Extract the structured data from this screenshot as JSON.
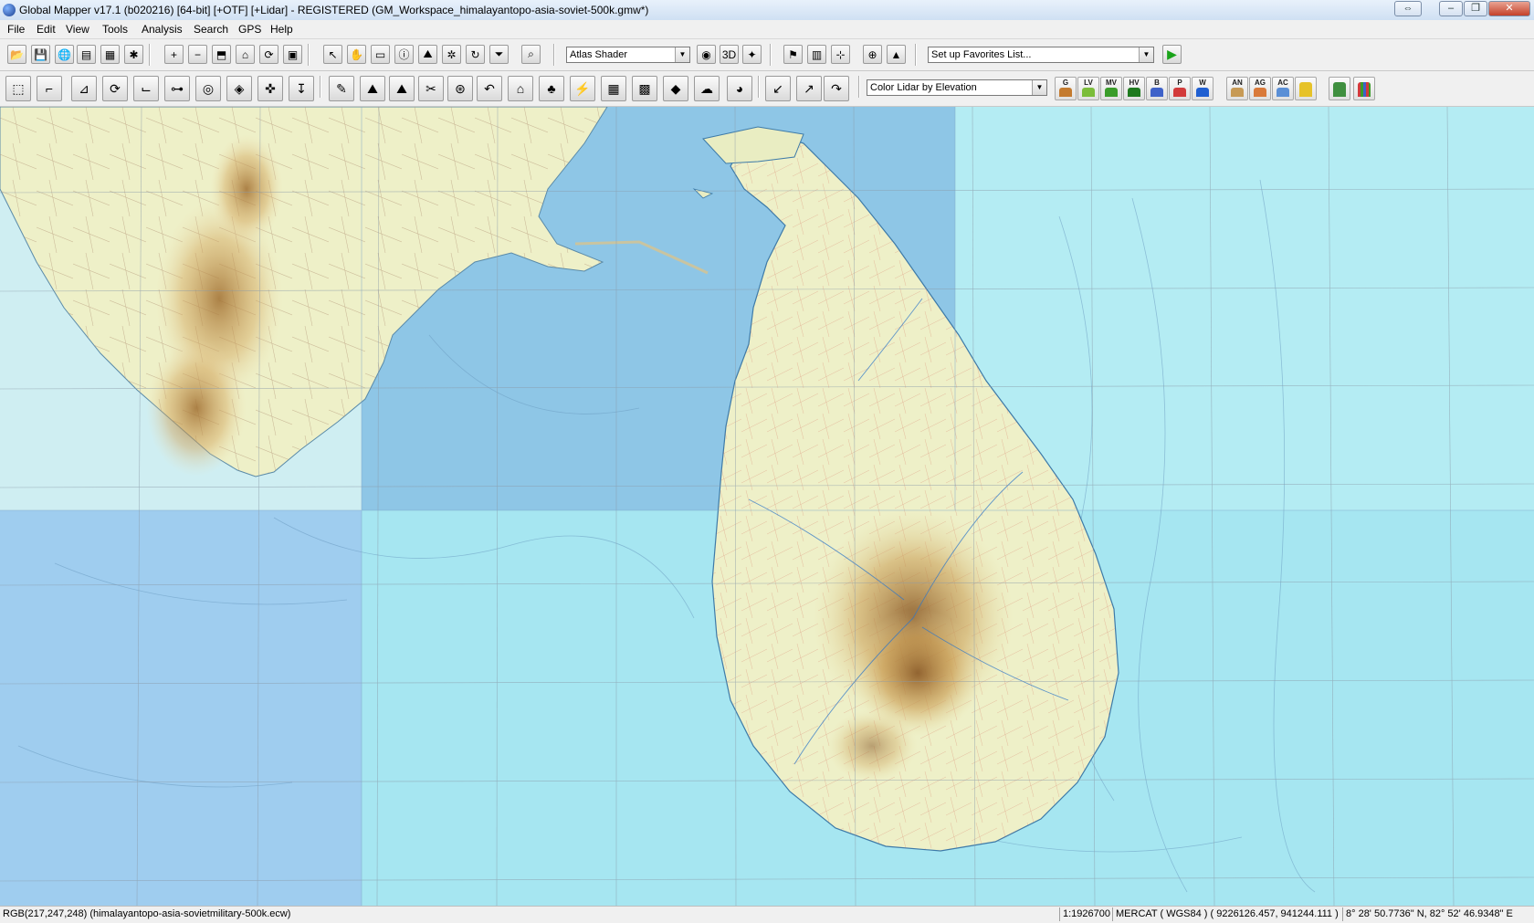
{
  "window": {
    "title": "Global Mapper v17.1 (b020216) [64-bit] [+OTF] [+Lidar] - REGISTERED (GM_Workspace_himalayantopo-asia-soviet-500k.gmw*)",
    "controls": {
      "restore_arrows": "⇔",
      "minimize": "–",
      "maximize": "❐",
      "close": "✕"
    }
  },
  "menu": [
    "File",
    "Edit",
    "View",
    "Tools",
    "Analysis",
    "Search",
    "GPS",
    "Help"
  ],
  "toolbar1": {
    "shader_select": "Atlas Shader",
    "favorites_select": "Set up Favorites List...",
    "run_icon": "play-triangle-icon"
  },
  "toolbar2": {
    "lidar_select": "Color Lidar by Elevation",
    "class_buttons": [
      "G",
      "LV",
      "MV",
      "HV",
      "B",
      "P",
      "W"
    ],
    "color_buttons": [
      "AN",
      "AG",
      "AC"
    ]
  },
  "status": {
    "pixel_info": "RGB(217,247,248) (himalayantopo-asia-sovietmilitary-500k.ecw)",
    "scale": "1:1926700",
    "projection": "MERCAT ( WGS84 ) ( 9226126.457, 941244.111 )",
    "latlon": "8° 28' 50.7736\" N, 82° 52' 46.9348\" E"
  },
  "colors": {
    "ocean": "#a6e6f1",
    "ocean_dark": "#8ec6e6",
    "land": "#eef0c8",
    "hill_shade": "#c89a50",
    "grid": "#8a9aa8"
  }
}
